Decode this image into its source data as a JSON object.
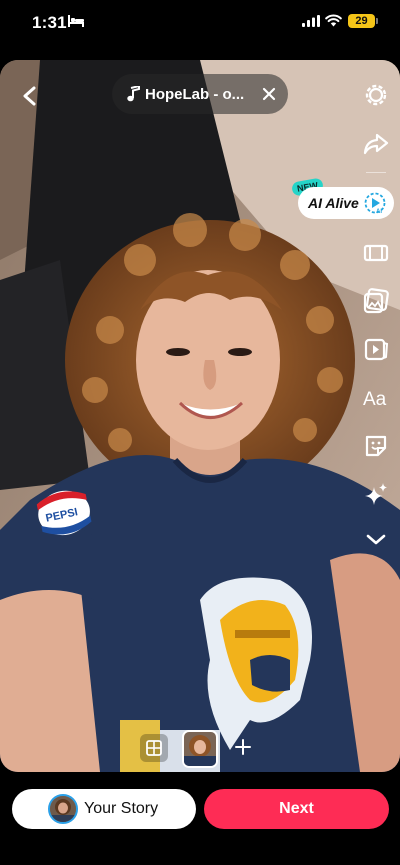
{
  "status_bar": {
    "time": "1:31",
    "battery": "29"
  },
  "header": {
    "sound_label": "HopeLab - o..."
  },
  "toolbar": {
    "tools": [
      "settings-icon",
      "share-icon",
      "ai-alive",
      "crop-icon",
      "photo-edit-icon",
      "video-icon",
      "text-icon",
      "sticker-icon",
      "effects-icon",
      "chevron-down-icon"
    ],
    "ai_alive": {
      "label": "AI Alive",
      "badge": "NEW",
      "icon_text": "AI"
    }
  },
  "photo": {
    "shirt_text": "PEPSI"
  },
  "bottom": {
    "your_story_label": "Your Story",
    "next_label": "Next"
  },
  "colors": {
    "accent": "#fe2c55",
    "new_badge": "#25d4c8",
    "shirt": "#24365a",
    "battery": "#f5c518"
  }
}
